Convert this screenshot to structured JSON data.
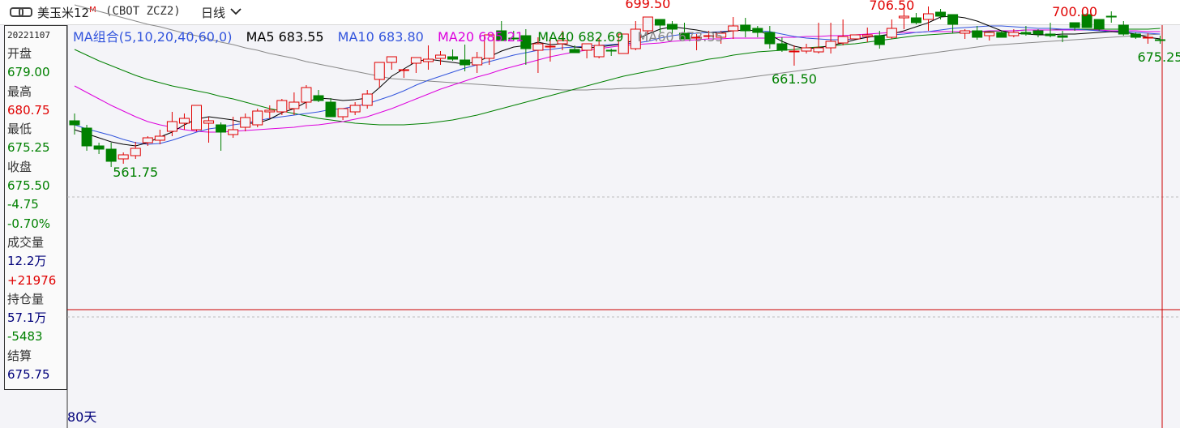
{
  "header": {
    "name": "美玉米12",
    "marker": "M",
    "code": "(CBOT ZCZ2)",
    "period": "日线"
  },
  "info": {
    "date": "20221107",
    "open_label": "开盘",
    "open": "679.00",
    "high_label": "最高",
    "high": "680.75",
    "low_label": "最低",
    "low": "675.25",
    "close_label": "收盘",
    "close": "675.50",
    "change": "-4.75",
    "change_pct": "-0.70%",
    "volume_label": "成交量",
    "volume": "12.2万",
    "volume_change": "+21976",
    "oi_label": "持仓量",
    "oi": "57.1万",
    "oi_change": "-5483",
    "settle_label": "结算",
    "settle": "675.75"
  },
  "legend": {
    "group": "MA组合(5,10,20,40,60,0)",
    "ma5": "MA5 683.55",
    "ma10": "MA10 683.80",
    "ma20": "MA20 685.21",
    "ma40": "MA40 682.69",
    "ma60": "MA60 673.35"
  },
  "colors": {
    "up": "#e00000",
    "down": "#008000",
    "ma5": "#000000",
    "ma10": "#3355dd",
    "ma20": "#dd00dd",
    "ma40": "#008000",
    "ma60": "#888888"
  },
  "chart_data": {
    "type": "candlestick",
    "bars_label": "80天",
    "annotations": [
      {
        "i": 5,
        "text": "561.75"
      },
      {
        "i": 47,
        "text": "699.50"
      },
      {
        "i": 59,
        "text": "661.50"
      },
      {
        "i": 67,
        "text": "706.50"
      },
      {
        "i": 82,
        "text": "700.00"
      },
      {
        "i": 89,
        "text": "675.25"
      }
    ],
    "ohlc": [
      [
        617,
        626,
        600,
        612
      ],
      [
        608,
        612,
        580,
        586
      ],
      [
        586,
        590,
        576,
        582
      ],
      [
        582,
        590,
        560,
        567
      ],
      [
        570,
        578,
        564,
        575
      ],
      [
        574,
        591,
        570,
        583
      ],
      [
        590,
        598,
        586,
        596
      ],
      [
        593,
        606,
        588,
        598
      ],
      [
        604,
        628,
        598,
        616
      ],
      [
        614,
        626,
        606,
        620
      ],
      [
        606,
        636,
        604,
        636
      ],
      [
        614,
        622,
        590,
        617
      ],
      [
        612,
        615,
        580,
        603
      ],
      [
        600,
        622,
        596,
        606
      ],
      [
        609,
        626,
        604,
        621
      ],
      [
        612,
        632,
        609,
        629
      ],
      [
        628,
        636,
        620,
        630
      ],
      [
        628,
        644,
        624,
        642
      ],
      [
        632,
        652,
        624,
        640
      ],
      [
        640,
        661,
        632,
        658
      ],
      [
        648,
        655,
        640,
        642
      ],
      [
        640,
        645,
        623,
        622
      ],
      [
        622,
        632,
        618,
        632
      ],
      [
        628,
        640,
        624,
        636
      ],
      [
        636,
        655,
        632,
        650
      ],
      [
        668,
        685,
        658,
        689
      ],
      [
        689,
        693,
        680,
        696
      ],
      [
        680,
        670,
        670,
        680
      ],
      [
        688,
        694,
        676,
        695
      ],
      [
        690,
        710,
        680,
        693
      ],
      [
        694,
        703,
        686,
        698
      ],
      [
        696,
        705,
        691,
        693
      ],
      [
        692,
        711,
        678,
        686
      ],
      [
        686,
        702,
        676,
        695
      ],
      [
        694,
        715,
        686,
        723
      ],
      [
        728,
        740,
        716,
        716
      ],
      [
        719,
        728,
        716,
        718
      ],
      [
        722,
        730,
        686,
        706
      ],
      [
        704,
        720,
        676,
        712
      ],
      [
        708,
        720,
        690,
        709
      ],
      [
        712,
        728,
        704,
        716
      ],
      [
        705,
        710,
        704,
        701
      ],
      [
        704,
        712,
        694,
        712
      ],
      [
        696,
        720,
        694,
        710
      ],
      [
        704,
        706,
        697,
        703
      ],
      [
        700,
        720,
        700,
        724
      ],
      [
        706,
        740,
        704,
        730
      ],
      [
        728,
        744,
        724,
        745
      ],
      [
        742,
        736,
        726,
        735
      ],
      [
        736,
        740,
        720,
        730
      ],
      [
        725,
        738,
        721,
        718
      ],
      [
        720,
        724,
        704,
        720
      ],
      [
        722,
        728,
        718,
        722
      ],
      [
        720,
        728,
        712,
        725
      ],
      [
        728,
        745,
        718,
        734
      ],
      [
        735,
        744,
        720,
        728
      ],
      [
        731,
        734,
        720,
        726
      ],
      [
        726,
        734,
        706,
        712
      ],
      [
        712,
        720,
        702,
        704
      ],
      [
        702,
        710,
        685,
        703
      ],
      [
        703,
        712,
        700,
        707
      ],
      [
        702,
        738,
        700,
        707
      ],
      [
        707,
        738,
        700,
        715
      ],
      [
        713,
        742,
        710,
        721
      ],
      [
        718,
        723,
        718,
        723
      ],
      [
        721,
        732,
        714,
        723
      ],
      [
        722,
        728,
        706,
        711
      ],
      [
        720,
        742,
        718,
        731
      ],
      [
        744,
        760,
        730,
        746
      ],
      [
        744,
        750,
        736,
        738
      ],
      [
        742,
        758,
        728,
        749
      ],
      [
        751,
        755,
        742,
        746
      ],
      [
        748,
        748,
        725,
        736
      ],
      [
        725,
        730,
        718,
        728
      ],
      [
        728,
        734,
        717,
        720
      ],
      [
        722,
        722,
        716,
        726
      ],
      [
        726,
        728,
        722,
        720
      ],
      [
        722,
        730,
        720,
        726
      ],
      [
        726,
        734,
        722,
        724
      ],
      [
        728,
        730,
        720,
        724
      ],
      [
        724,
        738,
        720,
        722
      ],
      [
        722,
        728,
        714,
        720
      ],
      [
        738,
        734,
        728,
        732
      ],
      [
        748,
        750,
        734,
        732
      ],
      [
        742,
        742,
        728,
        730
      ],
      [
        746,
        752,
        738,
        745
      ],
      [
        735,
        740,
        722,
        724
      ],
      [
        724,
        726,
        718,
        720
      ],
      [
        720,
        725,
        712,
        720
      ],
      [
        717,
        722,
        712,
        716
      ]
    ],
    "ma": {
      "ma5": [
        606,
        601,
        596,
        591,
        588,
        586,
        590,
        597,
        603,
        612,
        619,
        622,
        620,
        618,
        614,
        614,
        619,
        627,
        632,
        640,
        645,
        644,
        642,
        643,
        645,
        658,
        672,
        681,
        690,
        693,
        691,
        689,
        687,
        690,
        696,
        703,
        708,
        710,
        714,
        711,
        712,
        708,
        707,
        708,
        710,
        712,
        717,
        724,
        730,
        733,
        731,
        729,
        726,
        726,
        728,
        729,
        728,
        723,
        715,
        709,
        706,
        707,
        710,
        713,
        717,
        720,
        722,
        724,
        728,
        733,
        738,
        745,
        746,
        744,
        740,
        734,
        728,
        725,
        724,
        723,
        723,
        724,
        724,
        725,
        726,
        727,
        726,
        724,
        720,
        718
      ],
      "ma10": [
        612,
        607,
        603,
        599,
        594,
        590,
        588,
        589,
        593,
        598,
        603,
        607,
        609,
        612,
        614,
        617,
        620,
        622,
        624,
        626,
        628,
        631,
        632,
        635,
        638,
        643,
        648,
        654,
        661,
        667,
        672,
        677,
        682,
        686,
        690,
        694,
        698,
        701,
        704,
        705,
        707,
        708,
        709,
        710,
        711,
        712,
        713,
        715,
        719,
        722,
        724,
        725,
        726,
        727,
        728,
        729,
        728,
        727,
        724,
        721,
        719,
        718,
        717,
        717,
        718,
        720,
        722,
        723,
        724,
        726,
        727,
        729,
        731,
        732,
        733,
        734,
        734,
        733,
        732,
        731,
        731,
        730,
        730,
        729,
        728,
        727,
        727,
        726,
        725,
        724
      ],
      "ma20": [
        660,
        652,
        644,
        636,
        629,
        622,
        616,
        612,
        609,
        606,
        604,
        603,
        603,
        604,
        605,
        606,
        607,
        608,
        609,
        611,
        612,
        614,
        616,
        619,
        622,
        627,
        632,
        638,
        644,
        650,
        656,
        661,
        666,
        671,
        675,
        680,
        684,
        688,
        692,
        696,
        699,
        702,
        704,
        706,
        708,
        710,
        711,
        712,
        713,
        715,
        716,
        717,
        718,
        718,
        719,
        719,
        719,
        719,
        720,
        720,
        721,
        721,
        722,
        722,
        723,
        724,
        725,
        726,
        726,
        726,
        727,
        727,
        727,
        727,
        727,
        728,
        728,
        728,
        729,
        729,
        729,
        729,
        729,
        729,
        729,
        728,
        728,
        728,
        727,
        727
      ],
      "ma40": [
        705,
        698,
        691,
        685,
        679,
        673,
        668,
        664,
        660,
        657,
        654,
        651,
        647,
        644,
        640,
        636,
        632,
        629,
        626,
        623,
        620,
        618,
        616,
        614,
        613,
        612,
        612,
        612,
        613,
        614,
        616,
        618,
        621,
        624,
        628,
        632,
        636,
        640,
        644,
        648,
        652,
        656,
        660,
        664,
        668,
        672,
        675,
        678,
        681,
        684,
        687,
        690,
        693,
        695,
        698,
        700,
        702,
        703,
        704,
        705,
        707,
        708,
        709,
        711,
        712,
        714,
        716,
        718,
        720,
        722,
        723,
        724,
        725,
        726,
        727,
        727,
        728,
        728,
        729,
        729,
        729,
        730,
        730,
        730,
        730,
        730,
        730,
        730,
        730,
        731
      ],
      "ma60": [
        760,
        756,
        752,
        748,
        744,
        740,
        736,
        733,
        729,
        725,
        722,
        718,
        714,
        711,
        707,
        704,
        700,
        697,
        694,
        690,
        687,
        684,
        681,
        678,
        675,
        672,
        669,
        668,
        667,
        666,
        665,
        664,
        663,
        662,
        661,
        660,
        659,
        658,
        657,
        656,
        655,
        655,
        655,
        656,
        656,
        657,
        657,
        658,
        659,
        660,
        661,
        662,
        664,
        666,
        668,
        670,
        672,
        674,
        676,
        678,
        680,
        682,
        684,
        686,
        688,
        690,
        692,
        694,
        696,
        698,
        700,
        702,
        704,
        706,
        708,
        710,
        711,
        712,
        713,
        714,
        715,
        716,
        717,
        718,
        719,
        720,
        721,
        722,
        723,
        724
      ]
    }
  }
}
